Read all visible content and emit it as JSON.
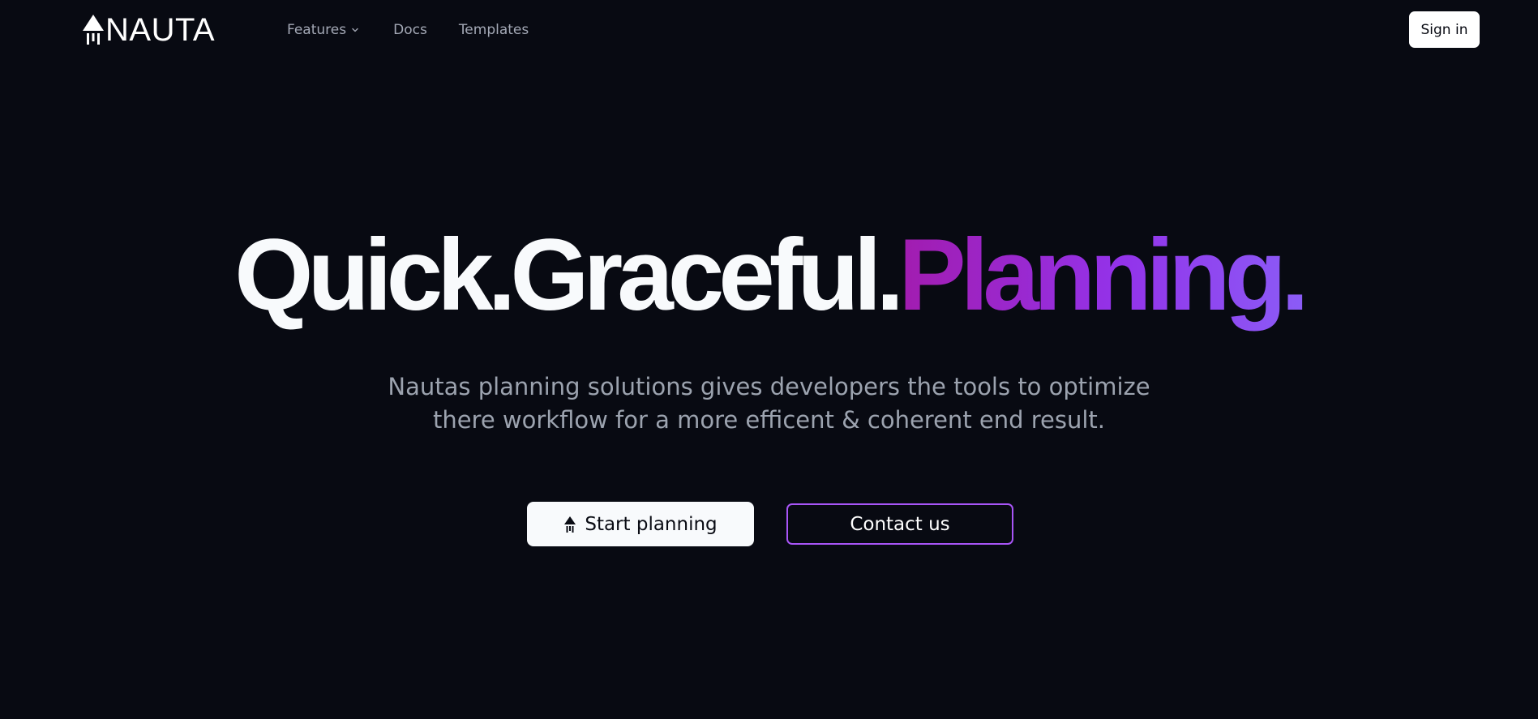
{
  "nav": {
    "logo_text": "NAUTA",
    "logo_icon": "rocket-icon",
    "links": {
      "features": "Features",
      "docs": "Docs",
      "templates": "Templates"
    },
    "sign_in": "Sign in"
  },
  "hero": {
    "headline_part1": "Quick.",
    "headline_part2": "Graceful.",
    "headline_part3": "Planning.",
    "subtitle_line1": "Nautas planning solutions gives developers the tools to optimize",
    "subtitle_line2": "there workflow for a more efficent & coherent end result.",
    "start_button": "Start planning",
    "contact_button": "Contact us"
  },
  "colors": {
    "background": "#080a12",
    "gradient_start": "#a21caf",
    "gradient_end": "#8b5cf6",
    "contact_border": "#a855f7"
  }
}
